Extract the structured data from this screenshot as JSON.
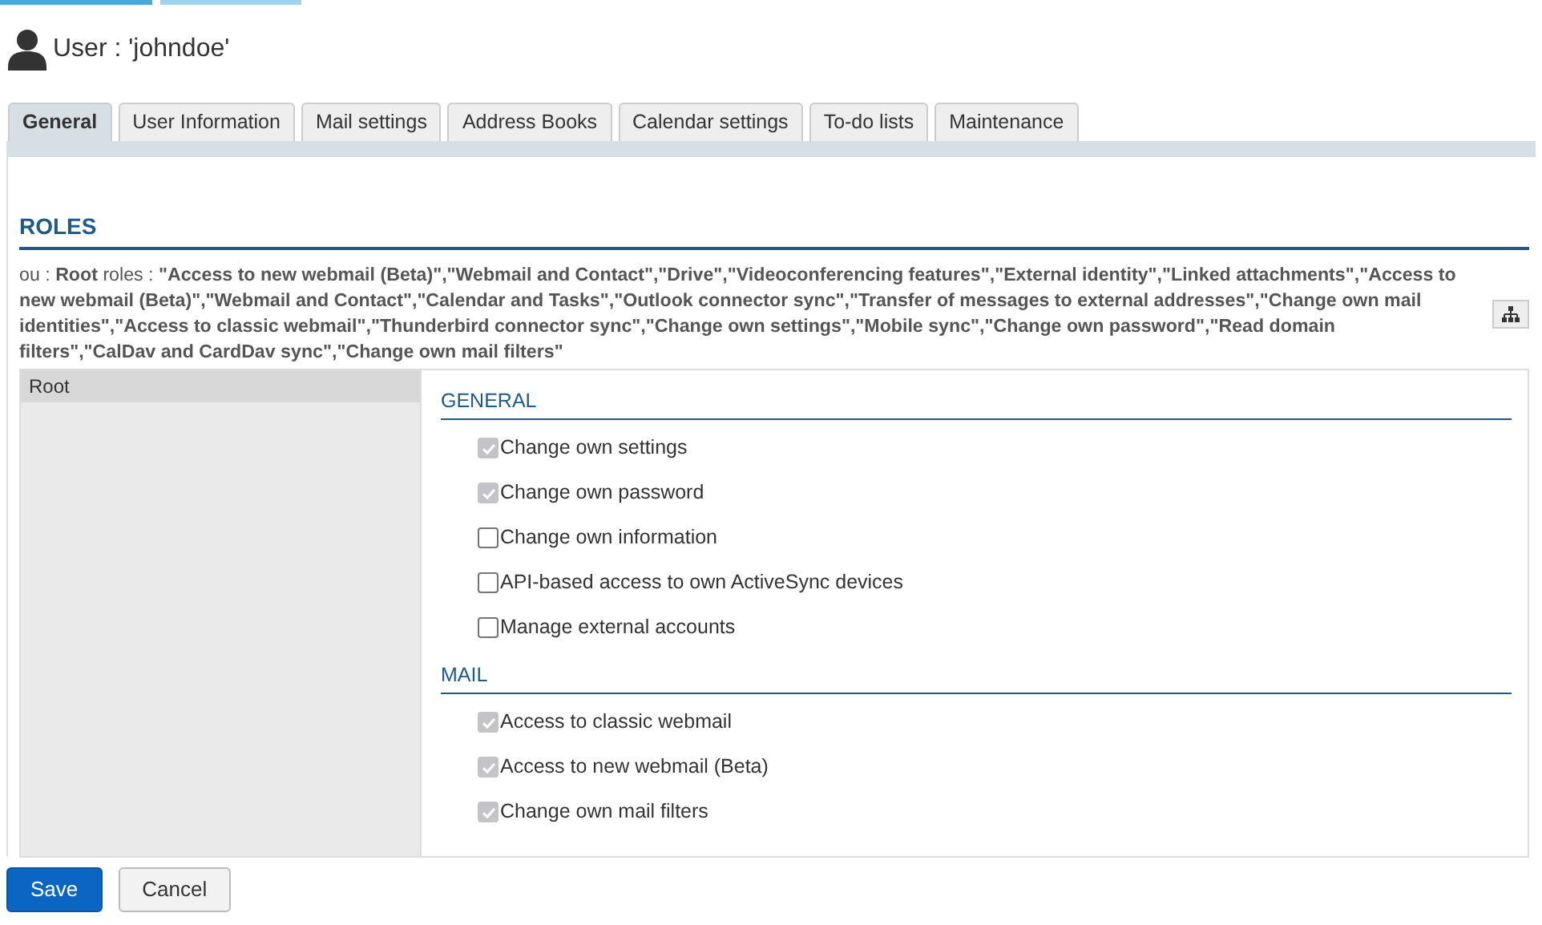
{
  "title": "User : 'johndoe'",
  "tabs": [
    {
      "label": "General",
      "selected": true
    },
    {
      "label": "User Information",
      "selected": false
    },
    {
      "label": "Mail settings",
      "selected": false
    },
    {
      "label": "Address Books",
      "selected": false
    },
    {
      "label": "Calendar settings",
      "selected": false
    },
    {
      "label": "To-do lists",
      "selected": false
    },
    {
      "label": "Maintenance",
      "selected": false
    }
  ],
  "section_title": "ROLES",
  "roles_text": "ou : **Root** roles : **\"Access to new webmail (Beta)\",\"Webmail and Contact\",\"Drive\",\"Videoconferencing features\",\"External identity\",\"Linked attachments\",\"Access to new webmail (Beta)\",\"Webmail and Contact\",\"Calendar and Tasks\",\"Outlook connector sync\",\"Transfer of messages to external addresses\",\"Change own mail identities\",\"Access to classic webmail\",\"Thunderbird connector sync\",\"Change own settings\",\"Mobile sync\",\"Change own password\",\"Read domain filters\",\"CalDav and CardDav sync\",\"Change own mail filters\"**",
  "ou_list": [
    {
      "label": "Root",
      "selected": true
    }
  ],
  "groups": [
    {
      "title": "GENERAL",
      "items": [
        {
          "label": "Change own settings",
          "checked": true,
          "disabled": true
        },
        {
          "label": "Change own password",
          "checked": true,
          "disabled": true
        },
        {
          "label": "Change own information",
          "checked": false,
          "disabled": false
        },
        {
          "label": "API-based access to own ActiveSync devices",
          "checked": false,
          "disabled": false
        },
        {
          "label": "Manage external accounts",
          "checked": false,
          "disabled": false
        }
      ]
    },
    {
      "title": "MAIL",
      "items": [
        {
          "label": "Access to classic webmail",
          "checked": true,
          "disabled": true
        },
        {
          "label": "Access to new webmail (Beta)",
          "checked": true,
          "disabled": true
        },
        {
          "label": "Change own mail filters",
          "checked": true,
          "disabled": true
        }
      ]
    }
  ],
  "buttons": [
    {
      "label": "Save",
      "kind": "primary"
    },
    {
      "label": "Cancel",
      "kind": "secondary"
    }
  ]
}
